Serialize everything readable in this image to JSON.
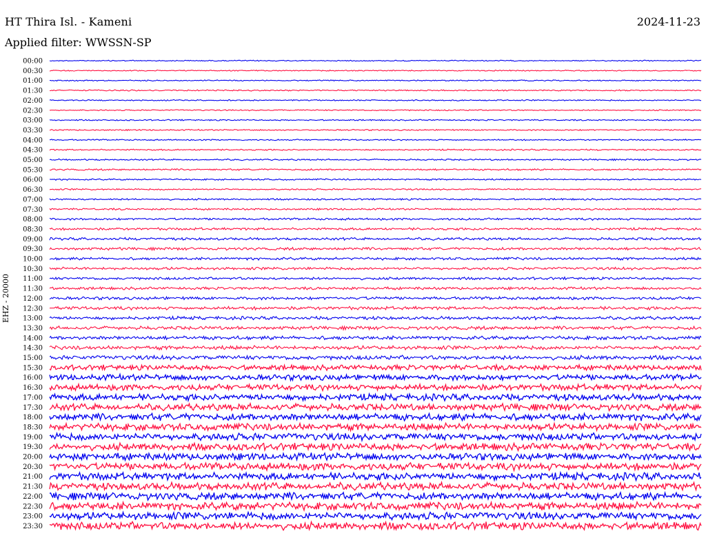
{
  "header": {
    "station": "HT Thira Isl. - Kameni",
    "date": "2024-11-23",
    "filter": "Applied filter: WWSSN-SP"
  },
  "chart_data": {
    "type": "line",
    "title": "HT Thira Isl. - Kameni",
    "date": "2024-11-23",
    "ylabel": "EHZ - 20000",
    "xlabel": "",
    "colors": [
      "#0000ee",
      "#ff1040"
    ],
    "rows": [
      {
        "label": "00:00",
        "level": 0.25
      },
      {
        "label": "00:30",
        "level": 0.25
      },
      {
        "label": "01:00",
        "level": 0.28
      },
      {
        "label": "01:30",
        "level": 0.3
      },
      {
        "label": "02:00",
        "level": 0.28
      },
      {
        "label": "02:30",
        "level": 0.28
      },
      {
        "label": "03:00",
        "level": 0.3
      },
      {
        "label": "03:30",
        "level": 0.3
      },
      {
        "label": "04:00",
        "level": 0.3
      },
      {
        "label": "04:30",
        "level": 0.32
      },
      {
        "label": "05:00",
        "level": 0.35
      },
      {
        "label": "05:30",
        "level": 0.38
      },
      {
        "label": "06:00",
        "level": 0.35
      },
      {
        "label": "06:30",
        "level": 0.35
      },
      {
        "label": "07:00",
        "level": 0.4
      },
      {
        "label": "07:30",
        "level": 0.42
      },
      {
        "label": "08:00",
        "level": 0.5
      },
      {
        "label": "08:30",
        "level": 0.55
      },
      {
        "label": "09:00",
        "level": 0.6
      },
      {
        "label": "09:30",
        "level": 0.62
      },
      {
        "label": "10:00",
        "level": 0.6
      },
      {
        "label": "10:30",
        "level": 0.62
      },
      {
        "label": "11:00",
        "level": 0.6
      },
      {
        "label": "11:30",
        "level": 0.62
      },
      {
        "label": "12:00",
        "level": 0.7
      },
      {
        "label": "12:30",
        "level": 0.75
      },
      {
        "label": "13:00",
        "level": 0.75
      },
      {
        "label": "13:30",
        "level": 0.8
      },
      {
        "label": "14:00",
        "level": 0.85
      },
      {
        "label": "14:30",
        "level": 0.9
      },
      {
        "label": "15:00",
        "level": 1.0
      },
      {
        "label": "15:30",
        "level": 1.2
      },
      {
        "label": "16:00",
        "level": 1.35
      },
      {
        "label": "16:30",
        "level": 1.4
      },
      {
        "label": "17:00",
        "level": 1.5
      },
      {
        "label": "17:30",
        "level": 1.55
      },
      {
        "label": "18:00",
        "level": 1.6
      },
      {
        "label": "18:30",
        "level": 1.6
      },
      {
        "label": "19:00",
        "level": 1.65
      },
      {
        "label": "19:30",
        "level": 1.65
      },
      {
        "label": "20:00",
        "level": 1.65
      },
      {
        "label": "20:30",
        "level": 1.7
      },
      {
        "label": "21:00",
        "level": 1.7
      },
      {
        "label": "21:30",
        "level": 1.7
      },
      {
        "label": "22:00",
        "level": 1.7
      },
      {
        "label": "22:30",
        "level": 1.75
      },
      {
        "label": "23:00",
        "level": 1.75
      },
      {
        "label": "23:30",
        "level": 1.8
      }
    ]
  }
}
